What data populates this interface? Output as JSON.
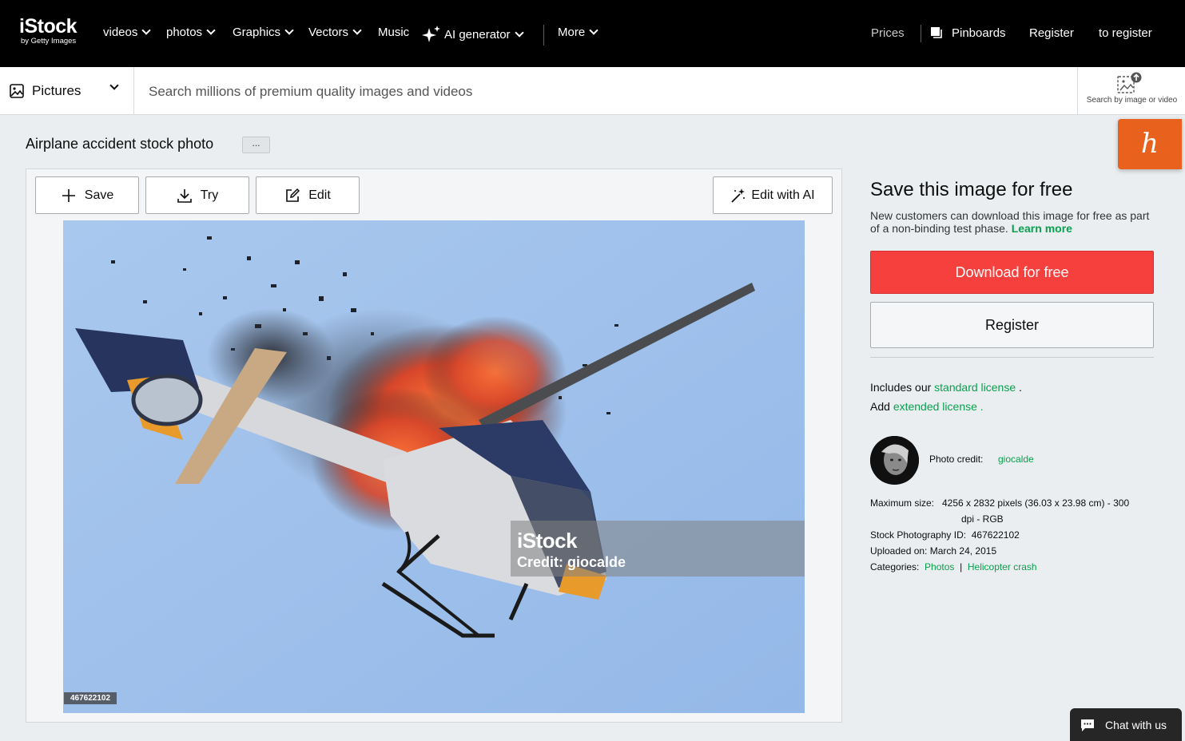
{
  "brand": {
    "name": "iStock",
    "sub": "by Getty Images"
  },
  "nav": {
    "items": [
      "videos",
      "photos",
      "Graphics",
      "Vectors",
      "Music",
      "AI generator",
      "More"
    ],
    "prices": "Prices",
    "pinboards": "Pinboards",
    "register": "Register",
    "to_register": "to register"
  },
  "search": {
    "media_type": "Pictures",
    "placeholder": "Search millions of premium quality images and videos",
    "by_image": "Search by image or video"
  },
  "page": {
    "title": "Airplane accident stock photo",
    "more": "..."
  },
  "toolbar": {
    "save": "Save",
    "try": "Try",
    "edit": "Edit",
    "edit_ai": "Edit with AI"
  },
  "photo": {
    "watermark_brand": "iStock",
    "watermark_credit": "Credit: giocalde",
    "id_badge": "467622102",
    "sky_color": "#a6c7ee"
  },
  "panel": {
    "heading": "Save this image for free",
    "desc": "New customers can download this image for free as part of a non-binding test phase.",
    "learn_more": "Learn more",
    "download": "Download for free",
    "register": "Register",
    "includes_prefix": "Includes our",
    "standard_license": "standard license",
    "includes_suffix": ".",
    "add_prefix": "Add",
    "extended_license": "extended license .",
    "credit_label": "Photo credit:",
    "credit_name": "giocalde",
    "max_size_label": "Maximum size:",
    "max_size_line1": "4256 x 2832 pixels (36.03 x 23.98 cm) - 300",
    "max_size_line2": "dpi - RGB",
    "stock_id_label": "Stock Photography ID:",
    "stock_id": "467622102",
    "uploaded_label": "Uploaded on:",
    "uploaded": "March 24, 2015",
    "categories_label": "Categories:",
    "category_1": "Photos",
    "category_sep": "|",
    "category_2": "Helicopter crash"
  },
  "chat": {
    "label": "Chat with us"
  },
  "colors": {
    "accent_green": "#08a14f",
    "download_red": "#f5403d",
    "honey_orange": "#e9621d"
  }
}
